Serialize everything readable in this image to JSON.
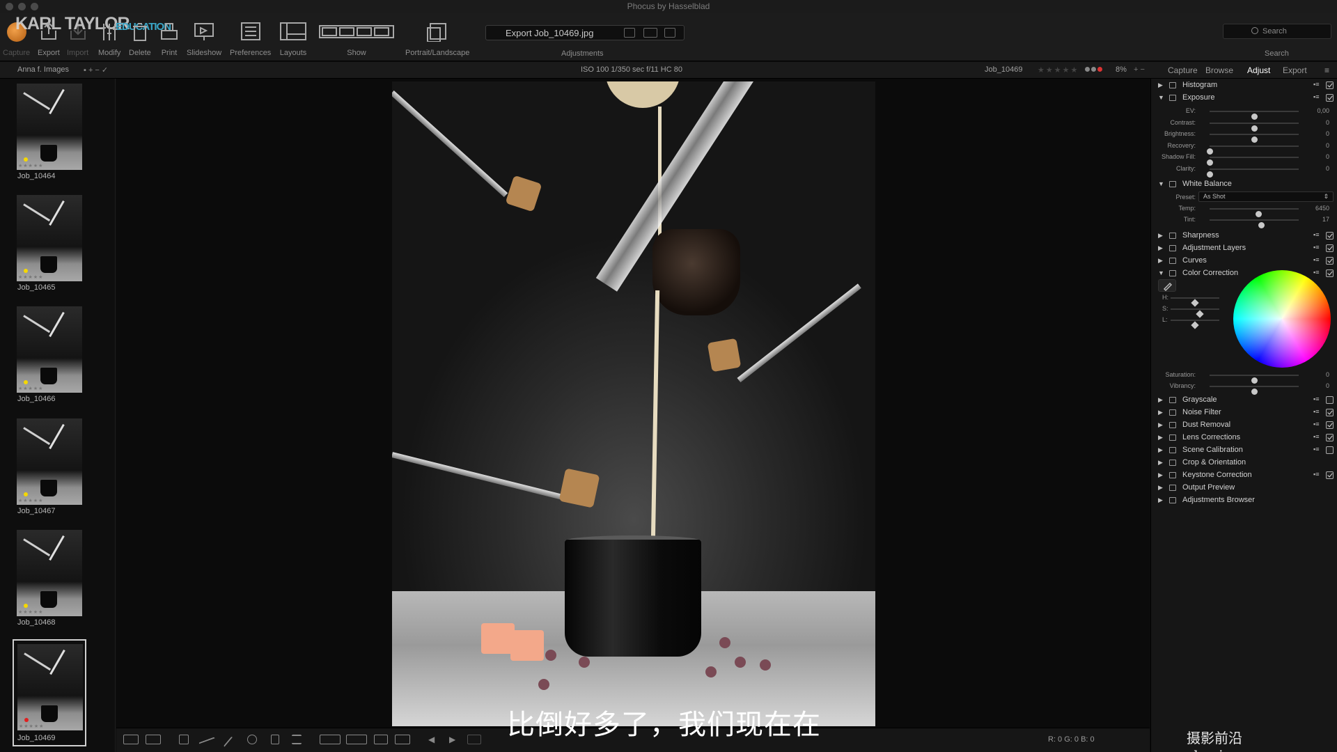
{
  "window": {
    "title": "Phocus by Hasselblad"
  },
  "branding": {
    "logo": "KARL TAYLOR",
    "logo_sub": "EDUCATION"
  },
  "toolbar": {
    "items": [
      {
        "label": "Capture",
        "icon": "capture-icon",
        "enabled": false
      },
      {
        "label": "Export",
        "icon": "export-icon",
        "enabled": true
      },
      {
        "label": "Import",
        "icon": "import-icon",
        "enabled": false
      },
      {
        "label": "Modify",
        "icon": "modify-icon",
        "enabled": true
      },
      {
        "label": "Delete",
        "icon": "delete-icon",
        "enabled": true
      },
      {
        "label": "Print",
        "icon": "print-icon",
        "enabled": true
      },
      {
        "label": "Slideshow",
        "icon": "slideshow-icon",
        "enabled": true
      },
      {
        "label": "Preferences",
        "icon": "preferences-icon",
        "enabled": true
      },
      {
        "label": "Layouts",
        "icon": "layouts-icon",
        "enabled": true
      },
      {
        "label": "Show",
        "icon": "show-icon",
        "enabled": true
      },
      {
        "label": "Portrait/Landscape",
        "icon": "portrait-landscape-icon",
        "enabled": true
      }
    ],
    "export_field": "Export Job_10469.jpg",
    "adjustments_label": "Adjustments",
    "search_placeholder": "Search",
    "search_label": "Search"
  },
  "infobar": {
    "folder": "Anna f. Images",
    "exif": "ISO 100   1/350 sec   f/11   HC 80",
    "filename": "Job_10469",
    "zoom": "8%",
    "color_tags": [
      "#d33",
      "#999",
      "#999"
    ]
  },
  "panel_tabs": [
    "Capture",
    "Browse",
    "Adjust",
    "Export"
  ],
  "panel_active_tab": "Adjust",
  "thumbnails": [
    {
      "name": "Job_10464"
    },
    {
      "name": "Job_10465"
    },
    {
      "name": "Job_10466"
    },
    {
      "name": "Job_10467"
    },
    {
      "name": "Job_10468"
    },
    {
      "name": "Job_10469",
      "selected": true
    }
  ],
  "adjust": {
    "histogram": "Histogram",
    "exposure": {
      "label": "Exposure",
      "sliders": [
        {
          "label": "EV:",
          "value": "0,00",
          "level": 0.5
        },
        {
          "label": "Contrast:",
          "value": "0",
          "level": 0.5
        },
        {
          "label": "Brightness:",
          "value": "0",
          "level": 0.5
        },
        {
          "label": "Recovery:",
          "value": "0",
          "level": 0.0
        },
        {
          "label": "Shadow Fill:",
          "value": "0",
          "level": 0.0
        },
        {
          "label": "Clarity:",
          "value": "0",
          "level": 0.0
        }
      ]
    },
    "white_balance": {
      "label": "White Balance",
      "preset_label": "Preset:",
      "preset_value": "As Shot",
      "sliders": [
        {
          "label": "Temp:",
          "value": "6450",
          "level": 0.55
        },
        {
          "label": "Tint:",
          "value": "17",
          "level": 0.58
        }
      ]
    },
    "sharpness": "Sharpness",
    "adjustment_layers": "Adjustment Layers",
    "curves": "Curves",
    "color_correction": {
      "label": "Color Correction",
      "hsl": [
        {
          "label": "H:",
          "level": 0.5
        },
        {
          "label": "S:",
          "level": 0.6
        },
        {
          "label": "L:",
          "level": 0.5
        }
      ],
      "sliders": [
        {
          "label": "Saturation:",
          "value": "0",
          "level": 0.5
        },
        {
          "label": "Vibrancy:",
          "value": "0",
          "level": 0.5
        }
      ]
    },
    "tail_sections": [
      {
        "label": "Grayscale",
        "checked": false,
        "opt": true
      },
      {
        "label": "Noise Filter",
        "checked": true,
        "opt": true
      },
      {
        "label": "Dust Removal",
        "checked": true,
        "opt": true
      },
      {
        "label": "Lens Corrections",
        "checked": true,
        "opt": true
      },
      {
        "label": "Scene Calibration",
        "checked": false,
        "opt": true
      },
      {
        "label": "Crop & Orientation",
        "checked": null,
        "opt": false
      },
      {
        "label": "Keystone Correction",
        "checked": true,
        "opt": true
      },
      {
        "label": "Output Preview",
        "checked": null,
        "opt": false
      },
      {
        "label": "Adjustments Browser",
        "checked": null,
        "opt": false
      }
    ]
  },
  "bottombar": {
    "rgb": "R:   0  G:   0  B:   0"
  },
  "subtitle": "比倒好多了，我们现在在",
  "watermark": "摄影前沿 sheyingzyz.com"
}
